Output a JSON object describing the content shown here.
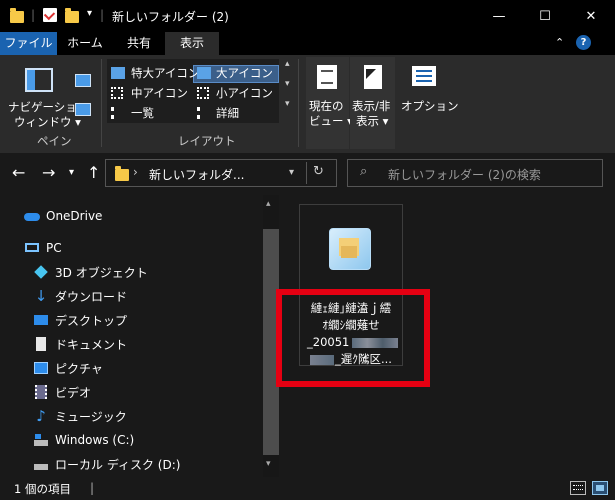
{
  "window": {
    "title": "新しいフォルダー (2)",
    "min_icon": "—",
    "max_icon": "☐",
    "close_icon": "✕"
  },
  "ribbon_tabs": [
    "ファイル",
    "ホーム",
    "共有",
    "表示"
  ],
  "ribbon": {
    "nav_pane_label_1": "ナビゲーション",
    "nav_pane_label_2": "ウィンドウ ▾",
    "pane_group": "ペイン",
    "layout_items": [
      "特大アイコン",
      "大アイコン",
      "中アイコン",
      "小アイコン",
      "一覧",
      "詳細"
    ],
    "layout_group": "レイアウト",
    "current_view_1": "現在の",
    "current_view_2": "ビュー ▾",
    "show_hide_1": "表示/非",
    "show_hide_2": "表示 ▾",
    "options": "オプション"
  },
  "address": {
    "path": "新しいフォルダ...",
    "search_placeholder": "新しいフォルダー (2)の検索"
  },
  "nav_items": [
    {
      "label": "OneDrive",
      "icon": "cloud-icon"
    },
    {
      "label": "PC",
      "icon": "pc-icon"
    },
    {
      "label": "3D オブジェクト",
      "icon": "3d-objects-icon"
    },
    {
      "label": "ダウンロード",
      "icon": "download-icon"
    },
    {
      "label": "デスクトップ",
      "icon": "desktop-icon"
    },
    {
      "label": "ドキュメント",
      "icon": "document-icon"
    },
    {
      "label": "ピクチャ",
      "icon": "pictures-icon"
    },
    {
      "label": "ビデオ",
      "icon": "video-icon"
    },
    {
      "label": "ミュージック",
      "icon": "music-icon"
    },
    {
      "label": "Windows (C:)",
      "icon": "drive-icon"
    },
    {
      "label": "ローカル ディスク (D:)",
      "icon": "drive-icon"
    }
  ],
  "file": {
    "line1": "縺ｪ縺｣縺溘ｊ繧",
    "line2": "ｵ繝ｼ繝薙せ",
    "line3": "_20051",
    "line4": "_遲ｸ隲区..."
  },
  "status": {
    "count": "1 個の項目"
  },
  "colors": {
    "accent": "#1a63b0",
    "highlight": "#e50012",
    "folder": "#f7c948"
  }
}
